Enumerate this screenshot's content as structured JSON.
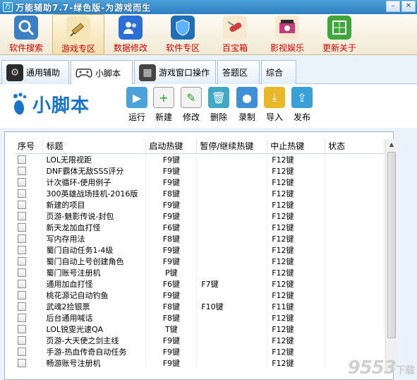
{
  "window": {
    "title": "万能辅助7.7-绿色版-为游戏而生"
  },
  "topnav": [
    {
      "label": "软件搜索",
      "icon": "search-icon",
      "color": "#3b7fc4"
    },
    {
      "label": "游戏专区",
      "icon": "syringe-icon",
      "color": "#c9a24a",
      "active": true
    },
    {
      "label": "数据修改",
      "icon": "users-icon",
      "color": "#2b6fd6"
    },
    {
      "label": "软件专区",
      "icon": "shield-icon",
      "color": "#1f6fb8"
    },
    {
      "label": "百宝箱",
      "icon": "swiss-knife-icon",
      "color": "#d63a3a"
    },
    {
      "label": "影视娱乐",
      "icon": "film-icon",
      "color": "#c43a7a"
    },
    {
      "label": "更新关于",
      "icon": "update-icon",
      "color": "#3ea63a"
    }
  ],
  "tabs": [
    {
      "label": "通用辅助",
      "icon": "gear-icon"
    },
    {
      "label": "小脚本",
      "icon": "gamepad-icon",
      "active": true
    },
    {
      "label": "游戏窗口操作",
      "icon": "window-icon"
    },
    {
      "label": "答题区"
    },
    {
      "label": "综合"
    }
  ],
  "logo_text": "小脚本",
  "toolbar": [
    {
      "label": "运行",
      "icon": "run-icon"
    },
    {
      "label": "新建",
      "icon": "new-icon"
    },
    {
      "label": "修改",
      "icon": "edit-icon"
    },
    {
      "label": "删除",
      "icon": "trash-icon"
    },
    {
      "label": "录制",
      "icon": "record-icon"
    },
    {
      "label": "导入",
      "icon": "import-icon"
    },
    {
      "label": "发布",
      "icon": "publish-icon"
    }
  ],
  "table": {
    "headers": [
      "序号",
      "标题",
      "启动热键",
      "暂停/继续热键",
      "中止热键",
      "状态"
    ],
    "rows": [
      [
        "LOL无限视距",
        "F9键",
        "",
        "F12键",
        ""
      ],
      [
        "DNF霸体无敌SSS评分",
        "F9键",
        "",
        "F12键",
        ""
      ],
      [
        "计次循环-使用例子",
        "F9键",
        "",
        "F12键",
        ""
      ],
      [
        "300英雄战场挂机-2016版",
        "F8键",
        "",
        "F12键",
        ""
      ],
      [
        "新建的项目",
        "F9键",
        "",
        "F12键",
        ""
      ],
      [
        "页游-魅影传说-封包",
        "F9键",
        "",
        "F12键",
        ""
      ],
      [
        "新天龙加血打怪",
        "F6键",
        "",
        "F12键",
        ""
      ],
      [
        "写内存用法",
        "F8键",
        "",
        "F12键",
        ""
      ],
      [
        "蜀门自动任务1-4级",
        "F9键",
        "",
        "F12键",
        ""
      ],
      [
        "蜀门自动上号创建角色",
        "F9键",
        "",
        "F12键",
        ""
      ],
      [
        "蜀门账号注册机",
        "P键",
        "",
        "F12键",
        ""
      ],
      [
        "通用加血打怪",
        "F6键",
        "F7键",
        "F12键",
        ""
      ],
      [
        "桃花源记自动钓鱼",
        "F9键",
        "",
        "F12键",
        ""
      ],
      [
        "武魂2捡银票",
        "F8键",
        "F10键",
        "F11键",
        ""
      ],
      [
        "后台通用喊话",
        "F8键",
        "",
        "F12键",
        ""
      ],
      [
        "LOL锐雯光速QA",
        "T键",
        "",
        "F12键",
        ""
      ],
      [
        "页游-大天使之剑主线",
        "F9键",
        "",
        "F12键",
        ""
      ],
      [
        "手游-热血传奇自动任务",
        "F9键",
        "",
        "F12键",
        ""
      ],
      [
        "畅游账号注册机",
        "F9键",
        "",
        "F12键",
        ""
      ]
    ]
  },
  "watermark": {
    "main": "9553",
    "sub": "下载"
  }
}
